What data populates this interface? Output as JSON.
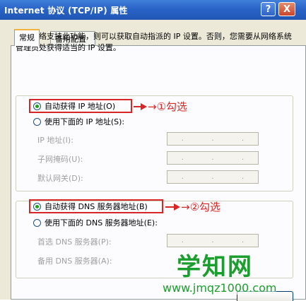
{
  "window": {
    "title": "Internet 协议 (TCP/IP) 属性",
    "help_glyph": "?",
    "close_glyph": "X"
  },
  "tabs": [
    {
      "label": "常规",
      "active": true
    },
    {
      "label": "备用配置",
      "active": false
    }
  ],
  "description": "如果网络支持此功能，则可以获取自动指派的 IP 设置。否则，您需要从网络系统管理员处获得适当的 IP 设置。",
  "ip_section": {
    "auto_option": "自动获得 IP 地址(O)",
    "manual_option": "使用下面的 IP 地址(S):",
    "fields": [
      {
        "label": "IP 地址(I):"
      },
      {
        "label": "子网掩码(U):"
      },
      {
        "label": "默认网关(D):"
      }
    ],
    "annotation": "→①勾选"
  },
  "dns_section": {
    "auto_option": "自动获得 DNS 服务器地址(B)",
    "manual_option": "使用下面的 DNS 服务器地址(E):",
    "fields": [
      {
        "label": "首选 DNS 服务器(P):"
      },
      {
        "label": "备用 DNS 服务器(A):"
      }
    ],
    "annotation": "→②勾选"
  },
  "ip_dots": [
    ".",
    ".",
    "."
  ],
  "watermark": {
    "brand": "学知网",
    "url": "www.jmqz1000.com"
  },
  "colors": {
    "titlebar": "#2a64c7",
    "highlight": "#d62626",
    "watermark": "#1a9e2e"
  }
}
